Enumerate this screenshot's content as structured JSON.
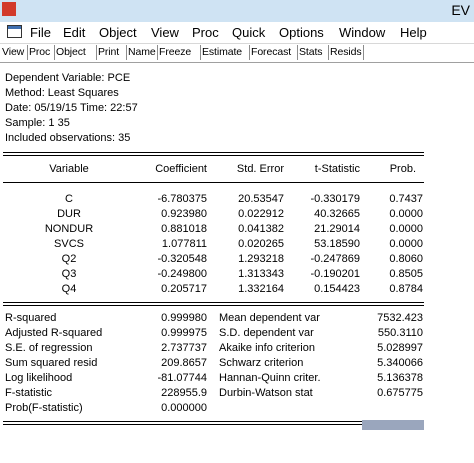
{
  "app": {
    "title": "EV"
  },
  "menubar": {
    "items": [
      "File",
      "Edit",
      "Object",
      "View",
      "Proc",
      "Quick",
      "Options",
      "Window",
      "Help"
    ]
  },
  "toolbar": {
    "buttons": [
      "View",
      "Proc",
      "Object",
      "Print",
      "Name",
      "Freeze",
      "Estimate",
      "Forecast",
      "Stats",
      "Resids"
    ]
  },
  "header": {
    "dependent": "Dependent Variable: PCE",
    "method": "Method: Least Squares",
    "date": "Date: 05/19/15   Time: 22:57",
    "sample": "Sample: 1 35",
    "obs": "Included observations: 35"
  },
  "table": {
    "columns": [
      "Variable",
      "Coefficient",
      "Std. Error",
      "t-Statistic",
      "Prob."
    ],
    "rows": [
      [
        "C",
        "-6.780375",
        "20.53547",
        "-0.330179",
        "0.7437"
      ],
      [
        "DUR",
        "0.923980",
        "0.022912",
        "40.32665",
        "0.0000"
      ],
      [
        "NONDUR",
        "0.881018",
        "0.041382",
        "21.29014",
        "0.0000"
      ],
      [
        "SVCS",
        "1.077811",
        "0.020265",
        "53.18590",
        "0.0000"
      ],
      [
        "Q2",
        "-0.320548",
        "1.293218",
        "-0.247869",
        "0.8060"
      ],
      [
        "Q3",
        "-0.249800",
        "1.313343",
        "-0.190201",
        "0.8505"
      ],
      [
        "Q4",
        "0.205717",
        "1.332164",
        "0.154423",
        "0.8784"
      ]
    ]
  },
  "stats": [
    [
      "R-squared",
      "0.999980",
      "Mean dependent var",
      "7532.423"
    ],
    [
      "Adjusted R-squared",
      "0.999975",
      "S.D. dependent var",
      "550.3110"
    ],
    [
      "S.E. of regression",
      "2.737737",
      "Akaike info criterion",
      "5.028997"
    ],
    [
      "Sum squared resid",
      "209.8657",
      "Schwarz criterion",
      "5.340066"
    ],
    [
      "Log likelihood",
      "-81.07744",
      "Hannan-Quinn criter.",
      "5.136378"
    ],
    [
      "F-statistic",
      "228955.9",
      "Durbin-Watson stat",
      "0.675775"
    ],
    [
      "Prob(F-statistic)",
      "0.000000",
      "",
      ""
    ]
  ]
}
